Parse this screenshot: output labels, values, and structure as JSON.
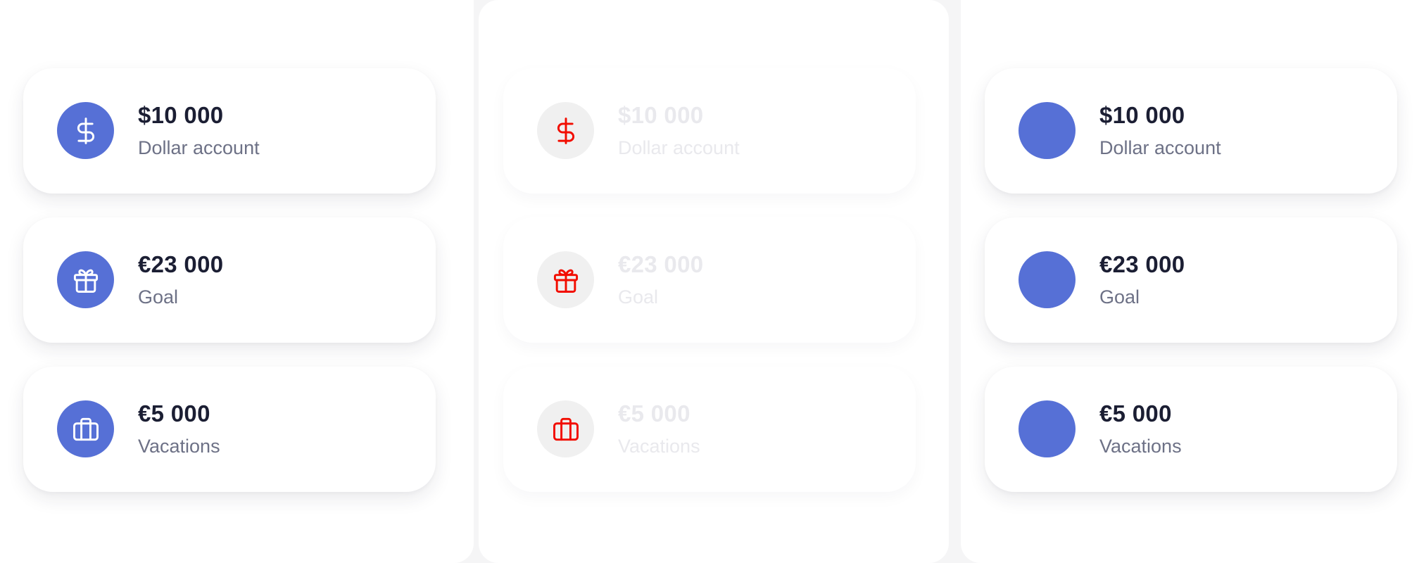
{
  "accent_color": "#5670d6",
  "variants": [
    {
      "style": "filled-icons",
      "icon_bg": "#5670d6",
      "icon_color": "#ffffff",
      "accounts": [
        {
          "amount": "$10 000",
          "label": "Dollar account",
          "icon": "dollar-icon"
        },
        {
          "amount": "€23 000",
          "label": "Goal",
          "icon": "gift-icon"
        },
        {
          "amount": "€5 000",
          "label": "Vacations",
          "icon": "briefcase-icon"
        }
      ]
    },
    {
      "style": "faded-placeholder",
      "icon_bg": "#f0f0f0",
      "icon_color": "#f20d00",
      "accounts": [
        {
          "amount": "$10 000",
          "label": "Dollar account",
          "icon": "dollar-icon"
        },
        {
          "amount": "€23 000",
          "label": "Goal",
          "icon": "gift-icon"
        },
        {
          "amount": "€5 000",
          "label": "Vacations",
          "icon": "briefcase-icon"
        }
      ]
    },
    {
      "style": "blank-icons",
      "icon_bg": "#5670d6",
      "icon_color": "",
      "accounts": [
        {
          "amount": "$10 000",
          "label": "Dollar account",
          "icon": ""
        },
        {
          "amount": "€23 000",
          "label": "Goal",
          "icon": ""
        },
        {
          "amount": "€5 000",
          "label": "Vacations",
          "icon": ""
        }
      ]
    }
  ]
}
